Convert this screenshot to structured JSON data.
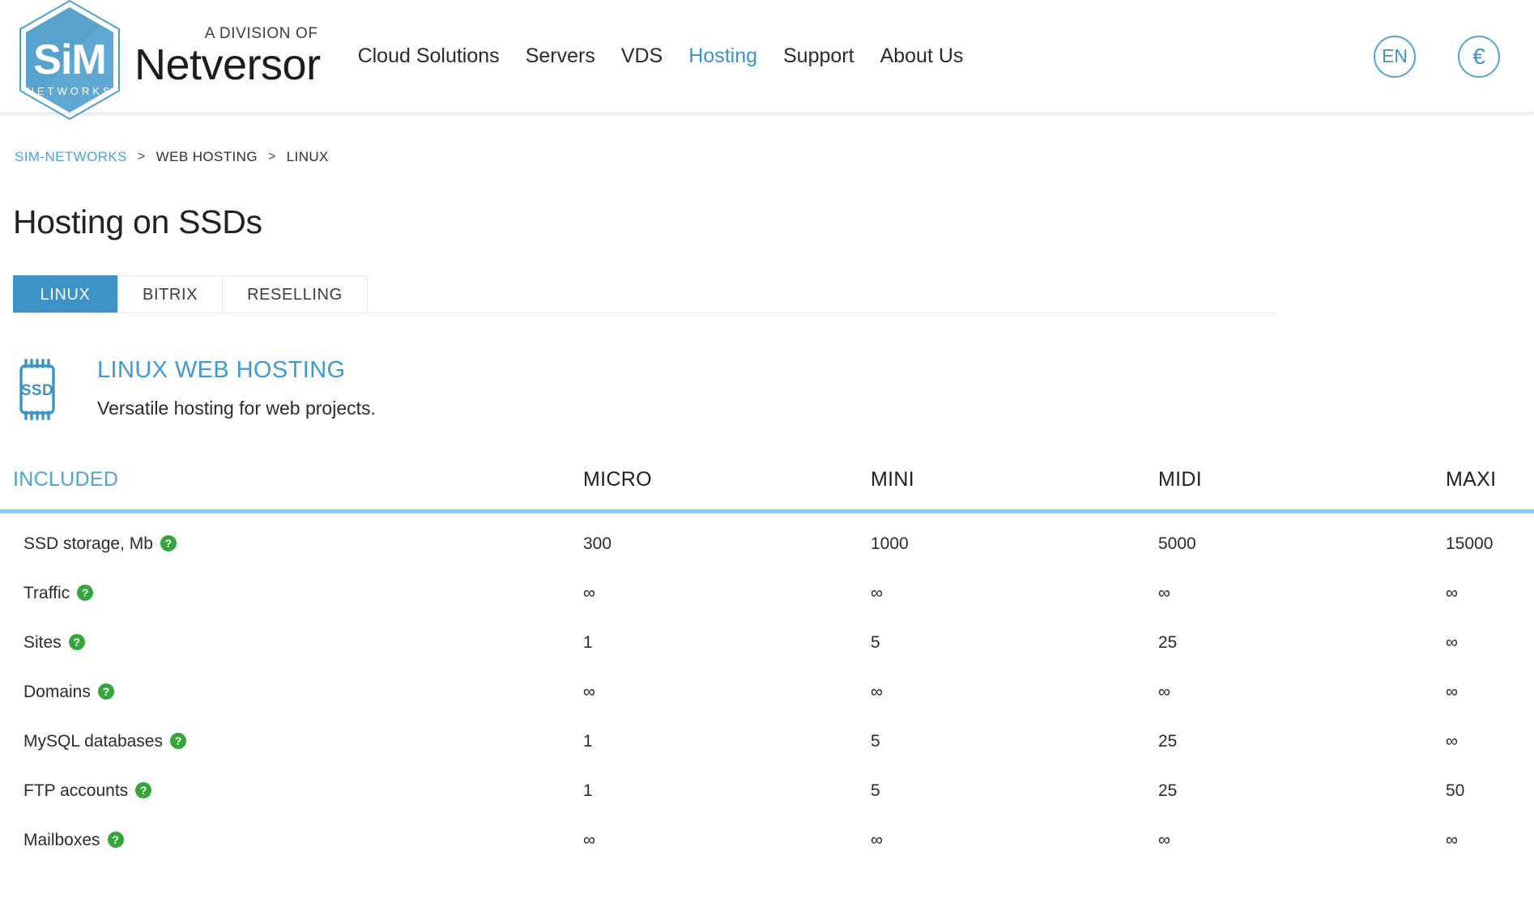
{
  "header": {
    "logo": {
      "mark_text": "SiM",
      "mark_sub": "NETWORKS",
      "division_label": "A DIVISION OF",
      "brand_name": "Netversor"
    },
    "nav": [
      {
        "label": "Cloud Solutions",
        "active": false
      },
      {
        "label": "Servers",
        "active": false
      },
      {
        "label": "VDS",
        "active": false
      },
      {
        "label": "Hosting",
        "active": true
      },
      {
        "label": "Support",
        "active": false
      },
      {
        "label": "About Us",
        "active": false
      }
    ],
    "language_button": "EN",
    "currency_button": "€"
  },
  "breadcrumb": {
    "items": [
      "SIM-NETWORKS",
      "WEB HOSTING",
      "LINUX"
    ],
    "separator": ">"
  },
  "page": {
    "title": "Hosting on SSDs"
  },
  "tabs": [
    {
      "label": "LINUX",
      "active": true
    },
    {
      "label": "BITRIX",
      "active": false
    },
    {
      "label": "RESELLING",
      "active": false
    }
  ],
  "product": {
    "icon_label": "SSD",
    "name": "LINUX WEB HOSTING",
    "description": "Versatile hosting for web projects."
  },
  "spec_table": {
    "columns": [
      "INCLUDED",
      "MICRO",
      "MINI",
      "MIDI",
      "MAXI"
    ],
    "help_glyph": "?",
    "rows": [
      {
        "feature": "SSD storage, Mb",
        "has_help": true,
        "values": [
          "300",
          "1000",
          "5000",
          "15000"
        ]
      },
      {
        "feature": "Traffic",
        "has_help": true,
        "values": [
          "∞",
          "∞",
          "∞",
          "∞"
        ]
      },
      {
        "feature": "Sites",
        "has_help": true,
        "values": [
          "1",
          "5",
          "25",
          "∞"
        ]
      },
      {
        "feature": "Domains",
        "has_help": true,
        "values": [
          "∞",
          "∞",
          "∞",
          "∞"
        ]
      },
      {
        "feature": "MySQL databases",
        "has_help": true,
        "values": [
          "1",
          "5",
          "25",
          "∞"
        ]
      },
      {
        "feature": "FTP accounts",
        "has_help": true,
        "values": [
          "1",
          "5",
          "25",
          "50"
        ]
      },
      {
        "feature": "Mailboxes",
        "has_help": true,
        "values": [
          "∞",
          "∞",
          "∞",
          "∞"
        ]
      }
    ]
  },
  "colors": {
    "accent_blue": "#3d93c8",
    "link_blue": "#4ba3dd",
    "divider_blue": "#85cdf2",
    "help_green": "#34a63b"
  }
}
